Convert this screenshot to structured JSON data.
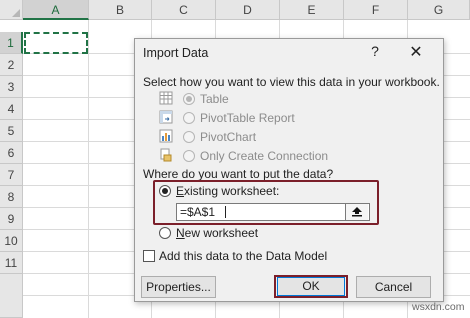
{
  "sheet": {
    "columns": [
      "A",
      "B",
      "C",
      "D",
      "E",
      "F",
      "G"
    ],
    "rows": [
      "1",
      "2",
      "3",
      "4",
      "5",
      "6",
      "7",
      "8",
      "9",
      "10",
      "11"
    ],
    "active_column": "A",
    "active_row": "1"
  },
  "dialog": {
    "title": "Import Data",
    "help_glyph": "?",
    "close_glyph": "✕",
    "view_prompt": "Select how you want to view this data in your workbook.",
    "view_options": [
      {
        "label": "Table",
        "icon": "table-icon",
        "selected": true,
        "enabled": false
      },
      {
        "label": "PivotTable Report",
        "icon": "pivot-table-icon",
        "selected": false,
        "enabled": false
      },
      {
        "label": "PivotChart",
        "icon": "pivot-chart-icon",
        "selected": false,
        "enabled": false
      },
      {
        "label": "Only Create Connection",
        "icon": "connection-icon",
        "selected": false,
        "enabled": false
      }
    ],
    "location_prompt": "Where do you want to put the data?",
    "existing_ws_label_pre": "",
    "existing_ws_label_u": "E",
    "existing_ws_label_post": "xisting worksheet:",
    "reference_value": "=$A$1",
    "collapse_glyph": "⬆",
    "new_ws_label_u": "N",
    "new_ws_label_post": "ew worksheet",
    "add_model_label": "Add this data to the Data Model",
    "add_model_checked": false,
    "properties_button": "Properties...",
    "ok_button": "OK",
    "cancel_button": "Cancel"
  },
  "watermark": "wsxdn.com",
  "colors": {
    "excel_green": "#217346",
    "highlight": "#7b1f2a",
    "dialog_bg": "#f0f0f0"
  }
}
